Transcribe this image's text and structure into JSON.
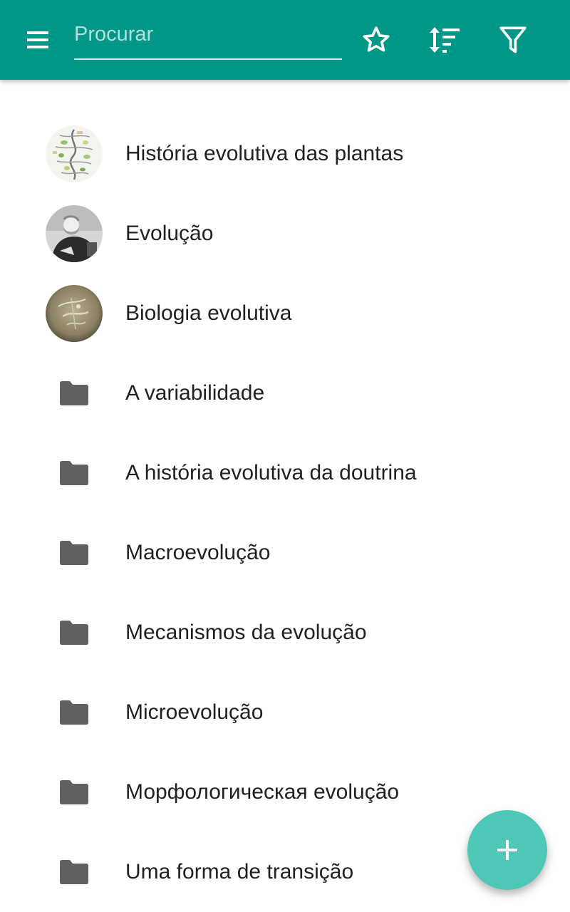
{
  "appbar": {
    "background_color": "#009688",
    "menu_icon": "hamburger-menu-icon",
    "search": {
      "placeholder": "Procurar",
      "value": ""
    },
    "actions": [
      {
        "icon": "star-outline-icon"
      },
      {
        "icon": "sort-icon"
      },
      {
        "icon": "filter-icon"
      }
    ]
  },
  "list": {
    "items": [
      {
        "label": "História evolutiva das plantas",
        "kind": "article",
        "thumbnail": "plant-evolution-diagram"
      },
      {
        "label": "Evolução",
        "kind": "article",
        "thumbnail": "darwin-portrait"
      },
      {
        "label": "Biologia evolutiva",
        "kind": "article",
        "thumbnail": "fossil-photo"
      },
      {
        "label": "A variabilidade",
        "kind": "folder",
        "icon": "folder-icon"
      },
      {
        "label": "A história evolutiva da doutrina",
        "kind": "folder",
        "icon": "folder-icon"
      },
      {
        "label": "Macroevolução",
        "kind": "folder",
        "icon": "folder-icon"
      },
      {
        "label": "Mecanismos da evolução",
        "kind": "folder",
        "icon": "folder-icon"
      },
      {
        "label": "Microevolução",
        "kind": "folder",
        "icon": "folder-icon"
      },
      {
        "label": "Морфологическая evolução",
        "kind": "folder",
        "icon": "folder-icon"
      },
      {
        "label": "Uma forma de transição",
        "kind": "folder",
        "icon": "folder-icon"
      }
    ]
  },
  "fab": {
    "icon": "plus-icon",
    "color": "#4fc7b6"
  },
  "colors": {
    "text": "#212121",
    "folder": "#616161",
    "placeholder": "#b2dfdb"
  }
}
